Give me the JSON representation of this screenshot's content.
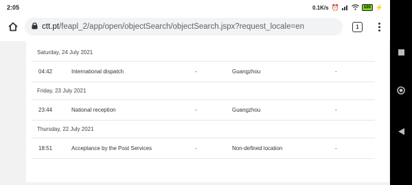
{
  "status_bar": {
    "time": "2:05",
    "speed": "0.1K/s",
    "battery": "100"
  },
  "browser": {
    "url_host": "ctt.pt",
    "url_path": "/feapl_2/app/open/objectSearch/objectSearch.jspx?request_locale=en",
    "tab_count": "1"
  },
  "tracking": {
    "groups": [
      {
        "date": "Saturday, 24 July 2021",
        "events": [
          {
            "time": "04:42",
            "description": "International dispatch",
            "detail": "-",
            "location": "Guangzhou",
            "extra": "-"
          }
        ]
      },
      {
        "date": "Friday, 23 July 2021",
        "events": [
          {
            "time": "23:44",
            "description": "National reception",
            "detail": "-",
            "location": "Guangzhou",
            "extra": "-"
          }
        ]
      },
      {
        "date": "Thursday, 22 July 2021",
        "events": [
          {
            "time": "18:51",
            "description": "Acceptance by the Post Services",
            "detail": "-",
            "location": "Non-defined location",
            "extra": "-"
          }
        ]
      }
    ]
  },
  "nav": {
    "recent_icon": "square-icon",
    "home_icon": "circle-icon",
    "back_icon": "triangle-back-icon"
  }
}
